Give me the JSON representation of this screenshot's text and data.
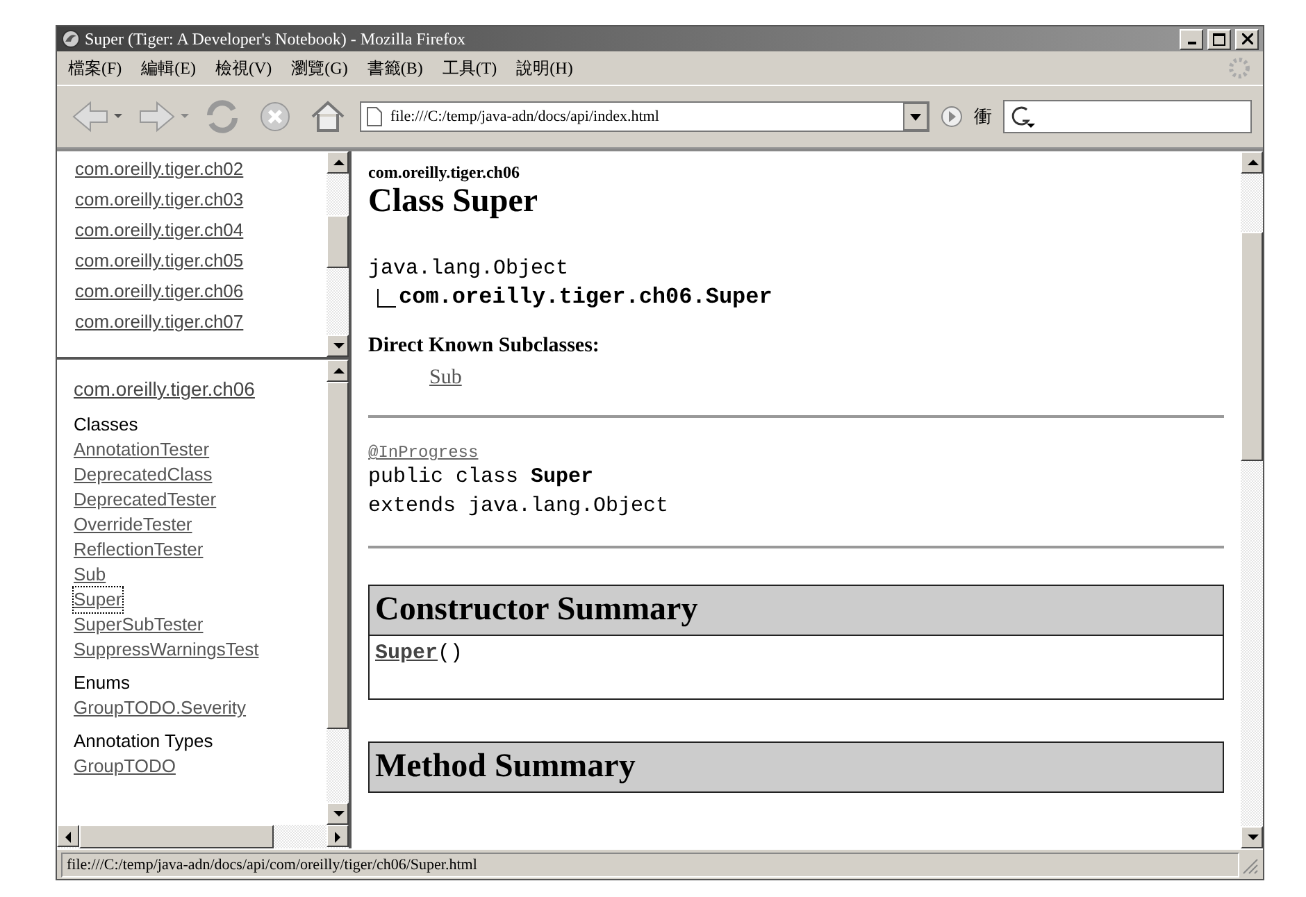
{
  "window": {
    "title": "Super (Tiger: A Developer's Notebook) - Mozilla Firefox"
  },
  "menu": [
    "檔案(F)",
    "編輯(E)",
    "檢視(V)",
    "瀏覽(G)",
    "書籤(B)",
    "工具(T)",
    "說明(H)"
  ],
  "toolbar": {
    "address": "file:///C:/temp/java-adn/docs/api/index.html",
    "go_label": "衝"
  },
  "packages": [
    "com.oreilly.tiger.ch02",
    "com.oreilly.tiger.ch03",
    "com.oreilly.tiger.ch04",
    "com.oreilly.tiger.ch05",
    "com.oreilly.tiger.ch06",
    "com.oreilly.tiger.ch07"
  ],
  "class_frame": {
    "package": "com.oreilly.tiger.ch06",
    "sections": [
      {
        "heading": "Classes",
        "items": [
          {
            "label": "AnnotationTester",
            "focused": false
          },
          {
            "label": "DeprecatedClass",
            "focused": false
          },
          {
            "label": "DeprecatedTester",
            "focused": false
          },
          {
            "label": "OverrideTester",
            "focused": false
          },
          {
            "label": "ReflectionTester",
            "focused": false
          },
          {
            "label": "Sub",
            "focused": false
          },
          {
            "label": "Super",
            "focused": true
          },
          {
            "label": "SuperSubTester",
            "focused": false
          },
          {
            "label": "SuppressWarningsTest",
            "focused": false
          }
        ]
      },
      {
        "heading": "Enums",
        "items": [
          {
            "label": "GroupTODO.Severity",
            "focused": false
          }
        ]
      },
      {
        "heading": "Annotation Types",
        "items": [
          {
            "label": "GroupTODO",
            "focused": false
          }
        ]
      }
    ]
  },
  "content": {
    "package": "com.oreilly.tiger.ch06",
    "title": "Class Super",
    "hierarchy": [
      "java.lang.Object",
      "com.oreilly.tiger.ch06.Super"
    ],
    "subclasses_heading": "Direct Known Subclasses:",
    "subclasses": [
      "Sub"
    ],
    "annotation": "@InProgress",
    "declaration": [
      "public class **Super**",
      "extends java.lang.Object"
    ],
    "summaries": [
      {
        "title": "Constructor Summary",
        "rows": [
          {
            "link": "Super",
            "rest": "()"
          }
        ]
      },
      {
        "title": "Method Summary"
      }
    ]
  },
  "status_bar": "file:///C:/temp/java-adn/docs/api/com/oreilly/tiger/ch06/Super.html"
}
